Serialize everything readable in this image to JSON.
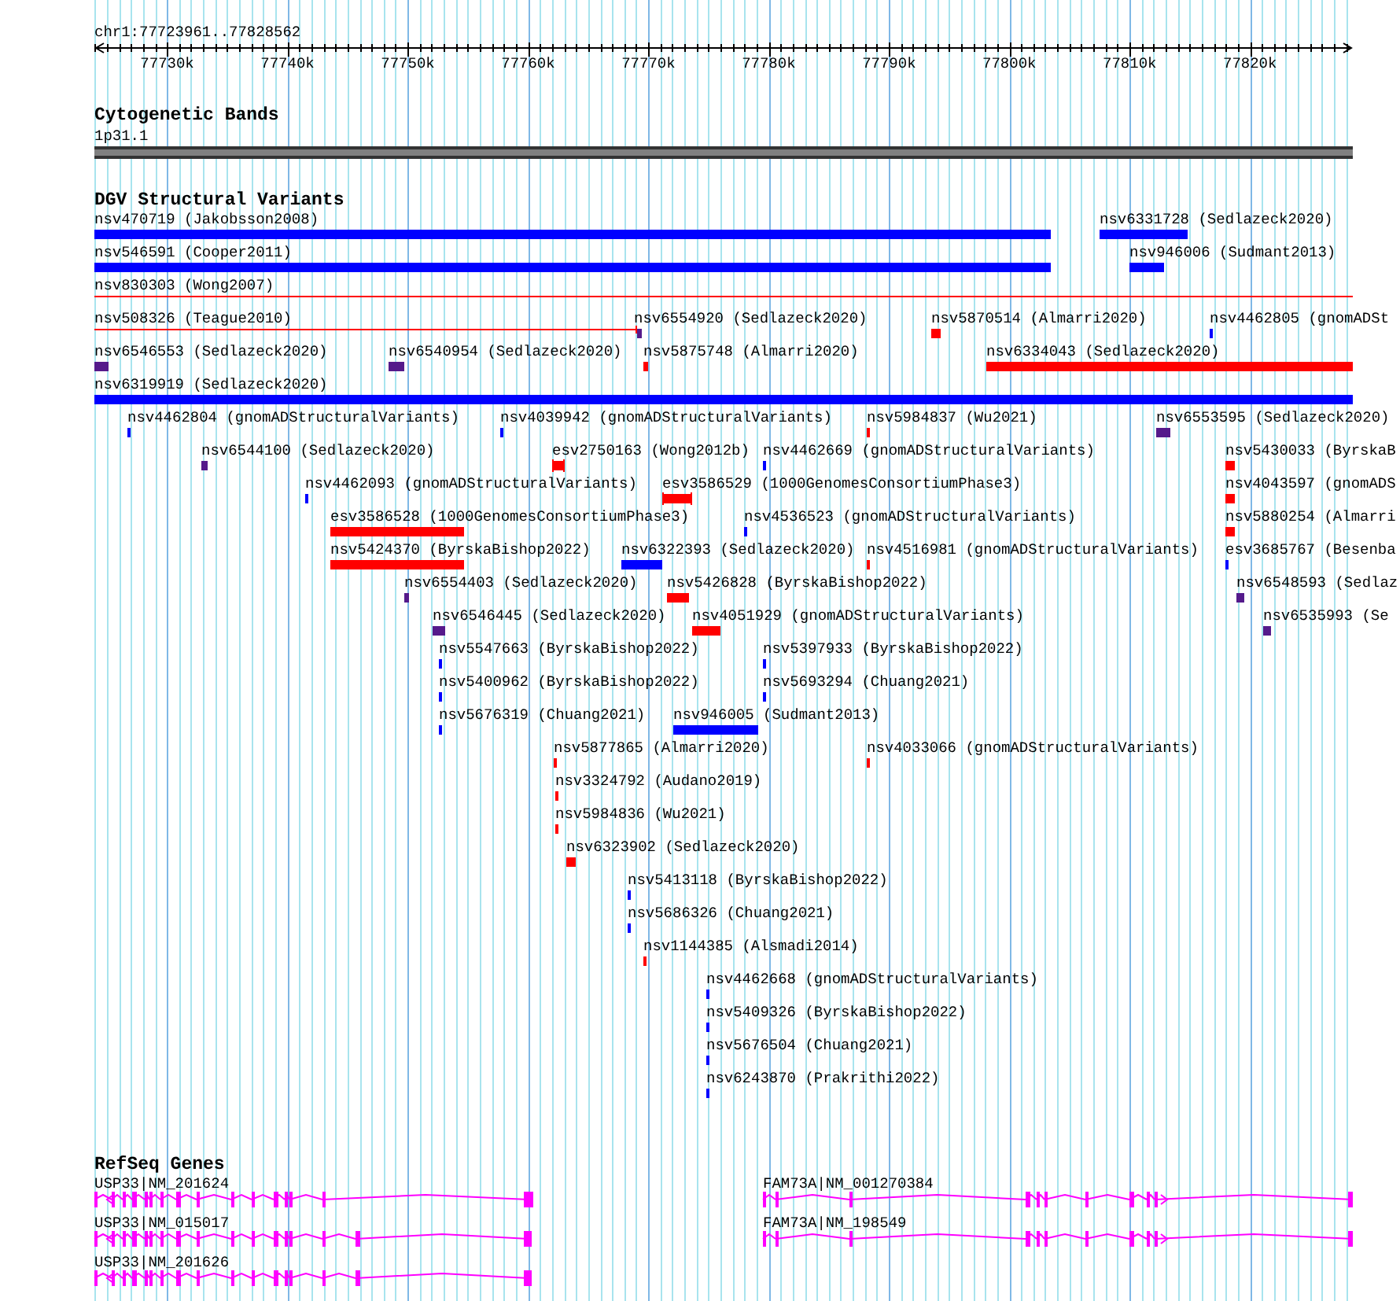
{
  "ruler": {
    "title": "chr1:77723961..77828562",
    "ticks": [
      "77730k",
      "77740k",
      "77750k",
      "77760k",
      "77770k",
      "77780k",
      "77790k",
      "77800k",
      "77810k",
      "77820k"
    ]
  },
  "cytogenetic_bands": {
    "title": "Cytogenetic Bands",
    "band": "1p31.1"
  },
  "dgv_structural_variants": {
    "title": "DGV Structural Variants",
    "variants": [
      {
        "label": "nsv470719 (Jakobsson2008)",
        "color": "#0000ff"
      },
      {
        "label": "nsv6331728 (Sedlazeck2020)",
        "color": "#0000ff"
      },
      {
        "label": "nsv546591 (Cooper2011)",
        "color": "#0000ff"
      },
      {
        "label": "nsv946006 (Sudmant2013)",
        "color": "#0000ff"
      },
      {
        "label": "nsv830303 (Wong2007)",
        "color": "#ff0000"
      },
      {
        "label": "nsv508326 (Teague2010)",
        "color": "#ff0000"
      },
      {
        "label": "nsv6554920 (Sedlazeck2020)",
        "color": "#551a8b"
      },
      {
        "label": "nsv5870514 (Almarri2020)",
        "color": "#ff0000"
      },
      {
        "label": "nsv4462805 (gnomADSt",
        "color": "#0000ff"
      },
      {
        "label": "nsv6546553 (Sedlazeck2020)",
        "color": "#551a8b"
      },
      {
        "label": "nsv6540954 (Sedlazeck2020)",
        "color": "#551a8b"
      },
      {
        "label": "nsv5875748 (Almarri2020)",
        "color": "#ff0000"
      },
      {
        "label": "nsv6334043 (Sedlazeck2020)",
        "color": "#ff0000"
      },
      {
        "label": "nsv6319919 (Sedlazeck2020)",
        "color": "#0000ff"
      },
      {
        "label": "nsv4462804 (gnomADStructuralVariants)",
        "color": "#0000ff"
      },
      {
        "label": "nsv4039942 (gnomADStructuralVariants)",
        "color": "#0000ff"
      },
      {
        "label": "nsv5984837 (Wu2021)",
        "color": "#ff0000"
      },
      {
        "label": "nsv6553595 (Sedlazeck2020)",
        "color": "#551a8b"
      },
      {
        "label": "nsv6544100 (Sedlazeck2020)",
        "color": "#551a8b"
      },
      {
        "label": "esv2750163 (Wong2012b)",
        "color": "#ff0000"
      },
      {
        "label": "nsv4462669 (gnomADStructuralVariants)",
        "color": "#0000ff"
      },
      {
        "label": "nsv5430033 (ByrskaB",
        "color": "#ff0000"
      },
      {
        "label": "nsv4462093 (gnomADStructuralVariants)",
        "color": "#0000ff"
      },
      {
        "label": "esv3586529 (1000GenomesConsortiumPhase3)",
        "color": "#ff0000"
      },
      {
        "label": "nsv4043597 (gnomADS",
        "color": "#ff0000"
      },
      {
        "label": "esv3586528 (1000GenomesConsortiumPhase3)",
        "color": "#ff0000"
      },
      {
        "label": "nsv4536523 (gnomADStructuralVariants)",
        "color": "#0000ff"
      },
      {
        "label": "nsv5880254 (Almarri",
        "color": "#ff0000"
      },
      {
        "label": "nsv5424370 (ByrskaBishop2022)",
        "color": "#ff0000"
      },
      {
        "label": "nsv6322393 (Sedlazeck2020)",
        "color": "#0000ff"
      },
      {
        "label": "nsv4516981 (gnomADStructuralVariants)",
        "color": "#ff0000"
      },
      {
        "label": "esv3685767 (Besenba",
        "color": "#0000ff"
      },
      {
        "label": "nsv6554403 (Sedlazeck2020)",
        "color": "#551a8b"
      },
      {
        "label": "nsv5426828 (ByrskaBishop2022)",
        "color": "#ff0000"
      },
      {
        "label": "nsv6548593 (Sedlaz",
        "color": "#551a8b"
      },
      {
        "label": "nsv6546445 (Sedlazeck2020)",
        "color": "#551a8b"
      },
      {
        "label": "nsv4051929 (gnomADStructuralVariants)",
        "color": "#ff0000"
      },
      {
        "label": "nsv6535993 (Se",
        "color": "#551a8b"
      },
      {
        "label": "nsv5547663 (ByrskaBishop2022)",
        "color": "#0000ff"
      },
      {
        "label": "nsv5397933 (ByrskaBishop2022)",
        "color": "#0000ff"
      },
      {
        "label": "nsv5400962 (ByrskaBishop2022)",
        "color": "#0000ff"
      },
      {
        "label": "nsv5693294 (Chuang2021)",
        "color": "#0000ff"
      },
      {
        "label": "nsv5676319 (Chuang2021)",
        "color": "#0000ff"
      },
      {
        "label": "nsv946005 (Sudmant2013)",
        "color": "#0000ff"
      },
      {
        "label": "nsv5877865 (Almarri2020)",
        "color": "#ff0000"
      },
      {
        "label": "nsv4033066 (gnomADStructuralVariants)",
        "color": "#ff0000"
      },
      {
        "label": "nsv3324792 (Audano2019)",
        "color": "#ff0000"
      },
      {
        "label": "nsv5984836 (Wu2021)",
        "color": "#ff0000"
      },
      {
        "label": "nsv6323902 (Sedlazeck2020)",
        "color": "#ff0000"
      },
      {
        "label": "nsv5413118 (ByrskaBishop2022)",
        "color": "#0000ff"
      },
      {
        "label": "nsv5686326 (Chuang2021)",
        "color": "#0000ff"
      },
      {
        "label": "nsv1144385 (Alsmadi2014)",
        "color": "#ff0000"
      },
      {
        "label": "nsv4462668 (gnomADStructuralVariants)",
        "color": "#0000ff"
      },
      {
        "label": "nsv5409326 (ByrskaBishop2022)",
        "color": "#0000ff"
      },
      {
        "label": "nsv5676504 (Chuang2021)",
        "color": "#0000ff"
      },
      {
        "label": "nsv6243870 (Prakrithi2022)",
        "color": "#0000ff"
      }
    ]
  },
  "refseq_genes": {
    "title": "RefSeq Genes",
    "transcripts": [
      {
        "label": "USP33|NM_201624"
      },
      {
        "label": "FAM73A|NM_001270384"
      },
      {
        "label": "USP33|NM_015017"
      },
      {
        "label": "FAM73A|NM_198549"
      },
      {
        "label": "USP33|NM_201626"
      }
    ]
  }
}
